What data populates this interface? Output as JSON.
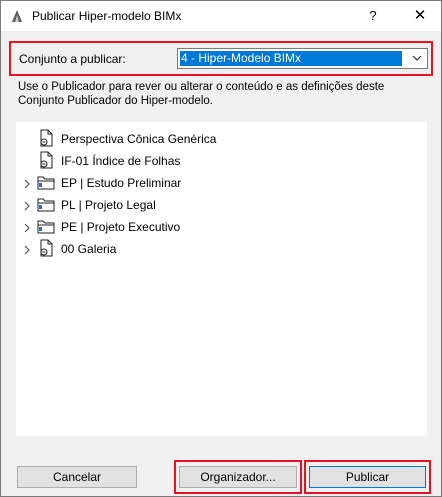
{
  "window": {
    "title": "Publicar Hiper-modelo BIMx",
    "help_glyph": "?",
    "close_glyph": "✕"
  },
  "publish_set": {
    "label": "Conjunto a publicar:",
    "selected": "4 - Hiper-Modelo BIMx"
  },
  "description": "Use o Publicador para rever ou alterar o conteúdo e as definições deste Conjunto Publicador do Hiper-modelo.",
  "tree": {
    "items": [
      {
        "label": "Perspectiva Cônica Genérica",
        "icon": "view-document-icon",
        "expandable": false
      },
      {
        "label": "IF-01 Índice de Folhas",
        "icon": "view-document-icon",
        "expandable": false
      },
      {
        "label": "EP | Estudo Preliminar",
        "icon": "folder-icon",
        "expandable": true
      },
      {
        "label": "PL | Projeto Legal",
        "icon": "folder-icon",
        "expandable": true
      },
      {
        "label": "PE | Projeto Executivo",
        "icon": "folder-icon",
        "expandable": true
      },
      {
        "label": "00 Galeria",
        "icon": "view-document-icon",
        "expandable": true
      }
    ]
  },
  "buttons": {
    "cancel": "Cancelar",
    "organizer": "Organizador...",
    "publish": "Publicar"
  },
  "colors": {
    "highlight_frame": "#e81123",
    "selection": "#0078d7"
  }
}
